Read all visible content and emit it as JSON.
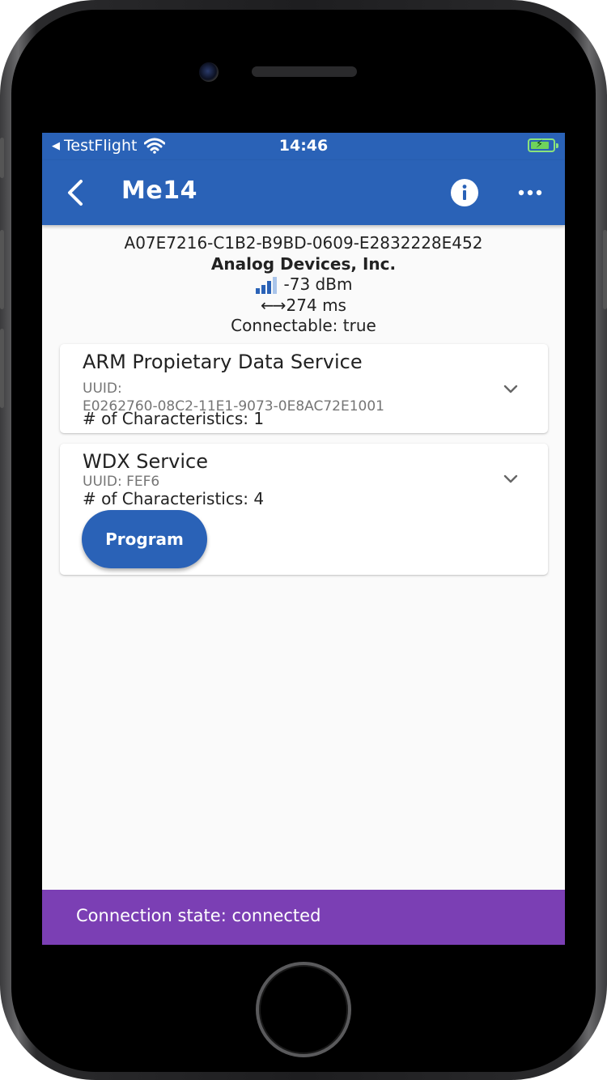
{
  "status_bar": {
    "back_app": "TestFlight",
    "time": "14:46"
  },
  "app_bar": {
    "title": "Me14"
  },
  "device": {
    "address": "A07E7216-C1B2-B9BD-0609-E2832228E452",
    "manufacturer": "Analog Devices, Inc.",
    "rssi": "-73 dBm",
    "interval_arrows": "←→",
    "interval": "274 ms",
    "connectable": "Connectable: true"
  },
  "services": [
    {
      "name": "ARM Propietary Data Service",
      "uuid_label": "UUID:",
      "uuid": "E0262760-08C2-11E1-9073-0E8AC72E1001",
      "characteristics": "# of Characteristics: 1"
    },
    {
      "name": "WDX Service",
      "uuid_line": "UUID: FEF6",
      "characteristics": "# of Characteristics: 4",
      "action_label": "Program"
    }
  ],
  "connection": {
    "state_text": "Connection state: connected"
  },
  "colors": {
    "primary": "#2a62b7",
    "connection_bar": "#7b3fb4",
    "background": "#fafafa"
  }
}
